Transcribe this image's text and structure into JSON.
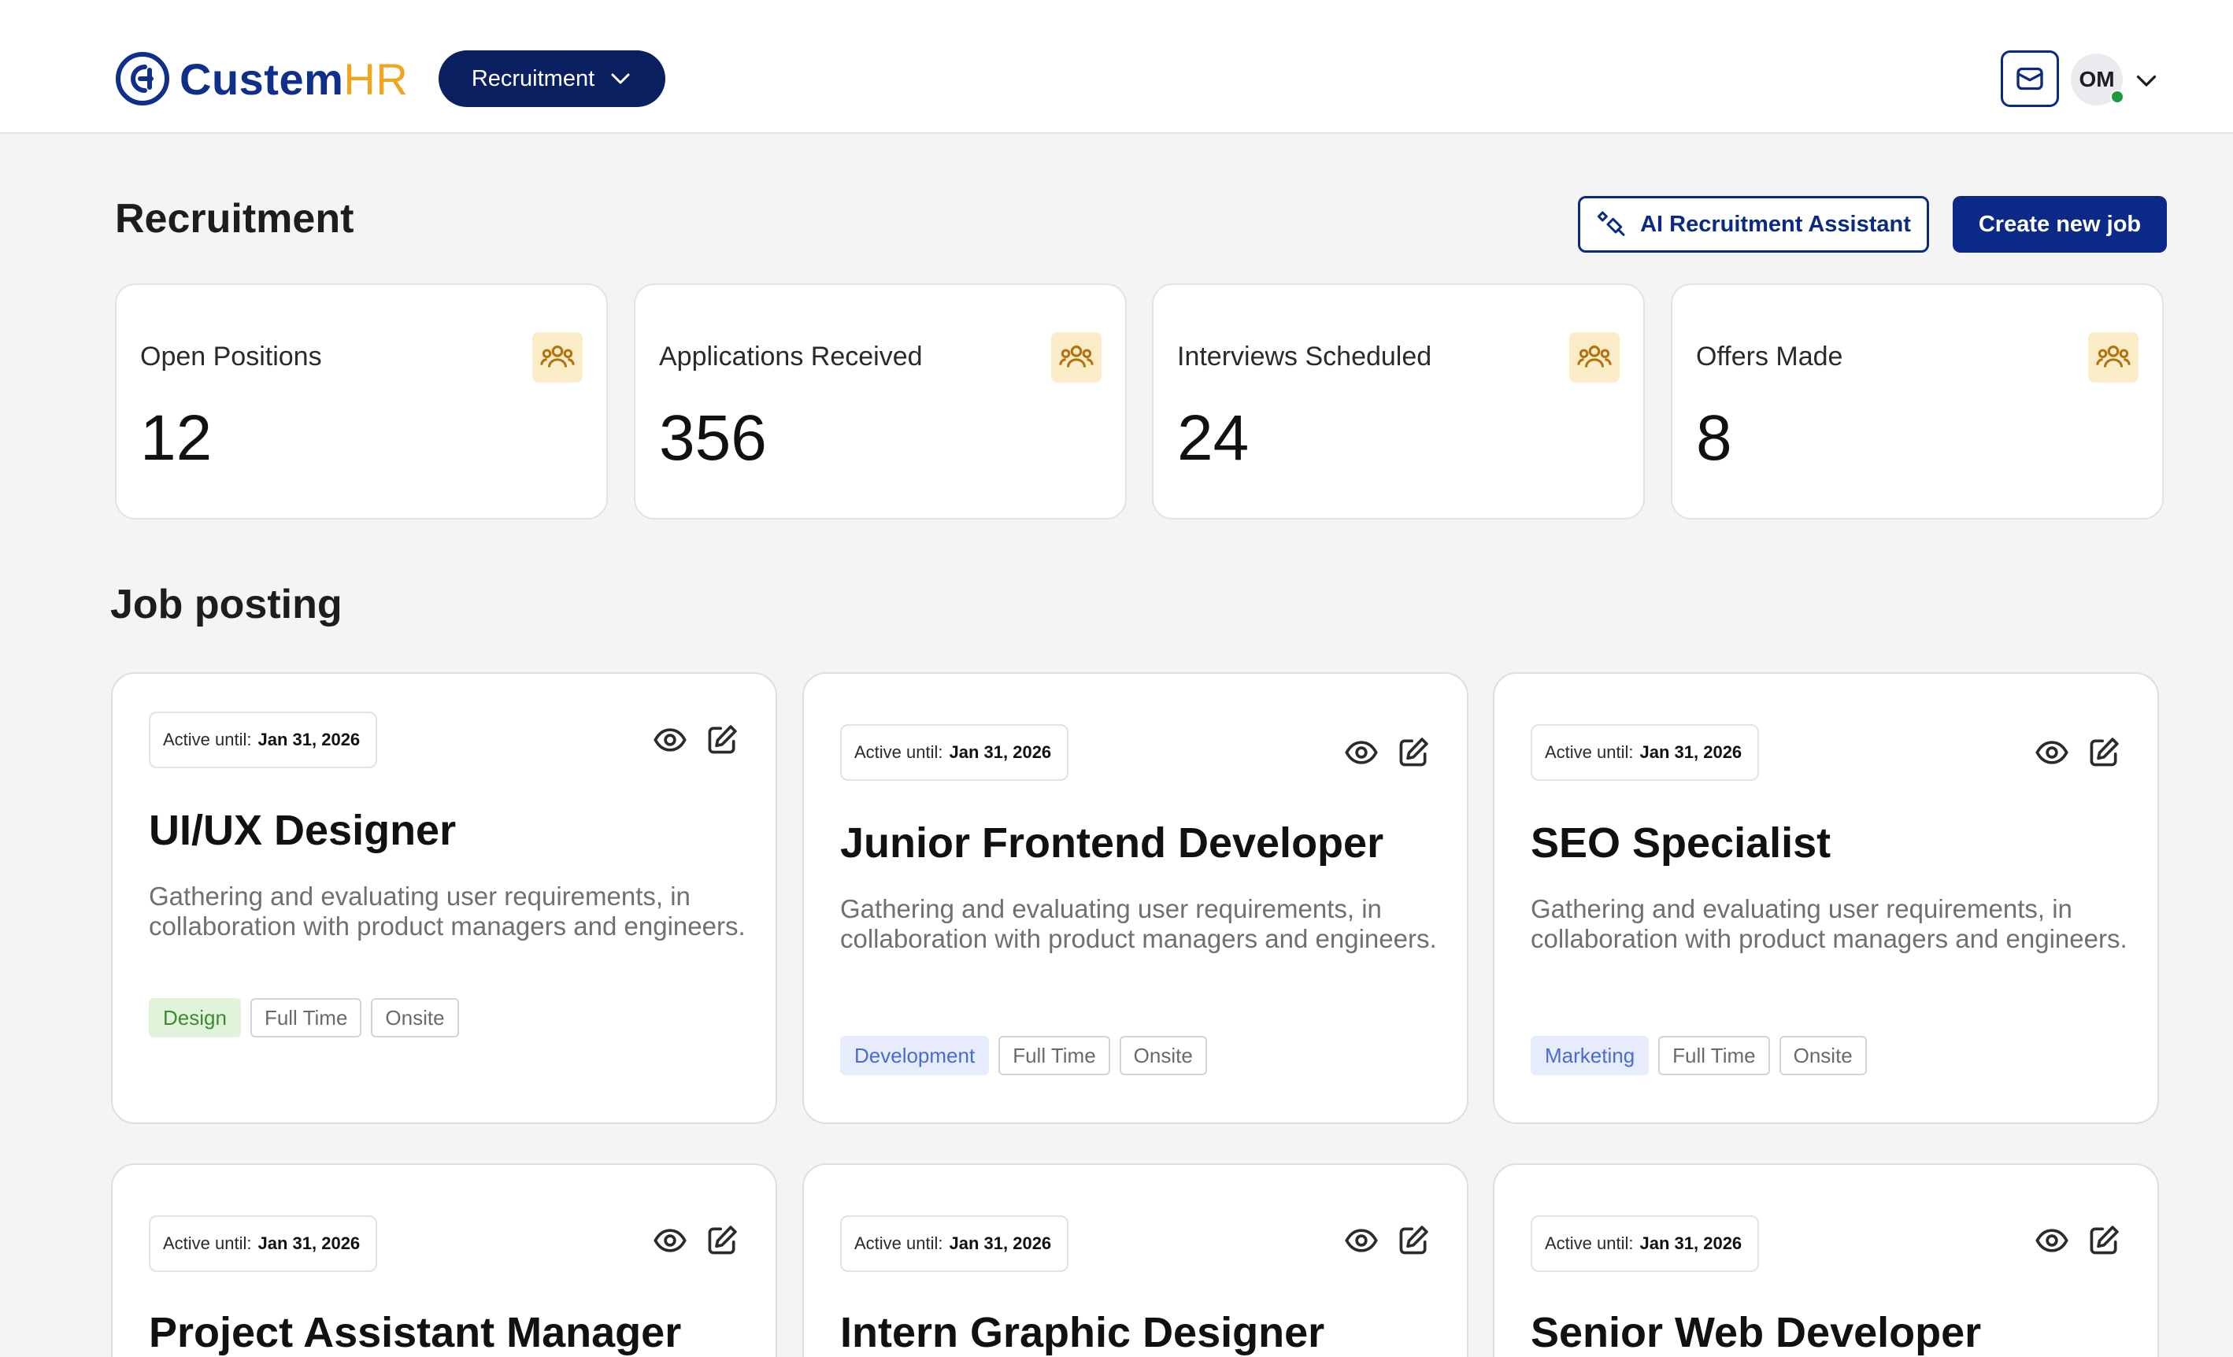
{
  "header": {
    "brand_part1": "Custem",
    "brand_part2": "HR",
    "module_label": "Recruitment",
    "avatar_initials": "OM",
    "icons": [
      "logo-mark-icon",
      "chevron-down-icon",
      "mail-icon"
    ]
  },
  "page": {
    "title": "Recruitment",
    "ai_button_label": "AI Recruitment Assistant",
    "create_button_label": "Create new job"
  },
  "stats": [
    {
      "label": "Open Positions",
      "value": "12",
      "icon": "users-icon"
    },
    {
      "label": "Applications Received",
      "value": "356",
      "icon": "users-icon"
    },
    {
      "label": "Interviews Scheduled",
      "value": "24",
      "icon": "users-icon"
    },
    {
      "label": "Offers Made",
      "value": "8",
      "icon": "users-icon"
    }
  ],
  "jobs_section": {
    "title": "Job posting",
    "active_label": "Active until:",
    "jobs": [
      {
        "active_until": "Jan 31, 2026",
        "title": "UI/UX Designer",
        "description": "Gathering and evaluating user requirements, in collaboration with product managers and engineers.",
        "tags": [
          "Design",
          "Full Time",
          "Onsite"
        ]
      },
      {
        "active_until": "Jan 31, 2026",
        "title": "Junior Frontend Developer",
        "description": "Gathering and evaluating user requirements, in collaboration with product managers and engineers.",
        "tags": [
          "Development",
          "Full Time",
          "Onsite"
        ]
      },
      {
        "active_until": "Jan 31, 2026",
        "title": "SEO Specialist",
        "description": "Gathering and evaluating user requirements, in collaboration with product managers and engineers.",
        "tags": [
          "Marketing",
          "Full Time",
          "Onsite"
        ]
      },
      {
        "active_until": "Jan 31, 2026",
        "title": "Project Assistant Manager"
      },
      {
        "active_until": "Jan 31, 2026",
        "title": "Intern Graphic Designer"
      },
      {
        "active_until": "Jan 31, 2026",
        "title": "Senior Web Developer"
      }
    ]
  },
  "colors": {
    "primary_navy": "#0b2060",
    "brand_blue": "#0f2f8a",
    "brand_orange": "#f0a51a",
    "stat_icon_bg": "#fbecc8",
    "design_tag": "#3c8a2f",
    "dev_tag": "#4a6bd0",
    "online_status": "#1f9a3a"
  }
}
